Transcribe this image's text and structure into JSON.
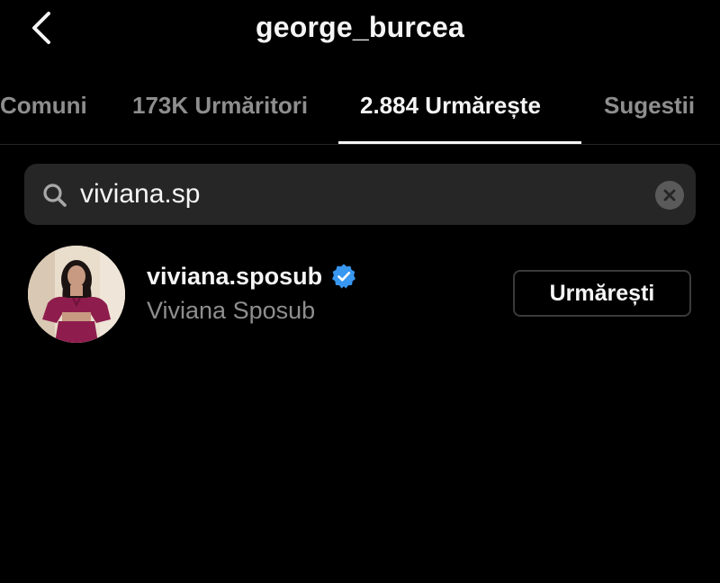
{
  "header": {
    "back_icon": "chevron-left-icon",
    "title": "george_burcea"
  },
  "tabs": [
    {
      "label": "Comuni",
      "active": false
    },
    {
      "label": "173K Urmăritori",
      "active": false
    },
    {
      "label": "2.884 Urmărește",
      "active": true
    },
    {
      "label": "Sugestii",
      "active": false
    }
  ],
  "search": {
    "icon": "search-icon",
    "value": "viviana.sp",
    "clear_icon": "clear-icon"
  },
  "results": [
    {
      "username": "viviana.sposub",
      "verified": true,
      "full_name": "Viviana Sposub",
      "button_label": "Urmărești"
    }
  ],
  "colors": {
    "background": "#000000",
    "primary_text": "#f5f5f5",
    "secondary_text": "#8e8e8e",
    "search_background": "#262626",
    "divider": "#262626",
    "verified_blue": "#3897f0",
    "button_border": "#3a3a3a"
  }
}
